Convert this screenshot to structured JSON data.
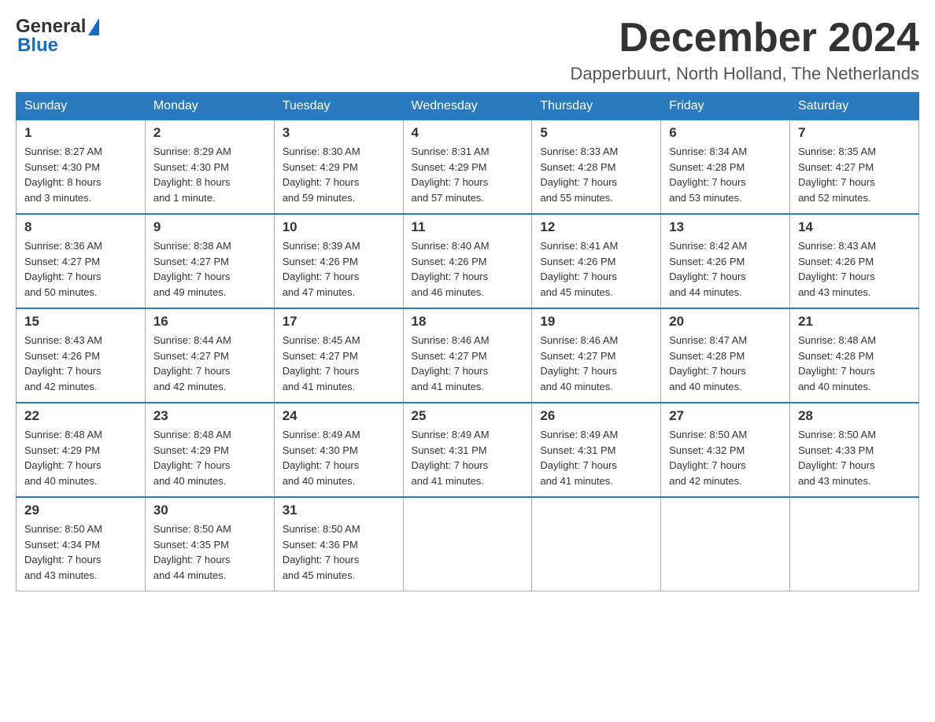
{
  "header": {
    "logo_general": "General",
    "logo_blue": "Blue",
    "month_title": "December 2024",
    "location": "Dapperbuurt, North Holland, The Netherlands"
  },
  "weekdays": [
    "Sunday",
    "Monday",
    "Tuesday",
    "Wednesday",
    "Thursday",
    "Friday",
    "Saturday"
  ],
  "weeks": [
    [
      {
        "day": "1",
        "sunrise": "Sunrise: 8:27 AM",
        "sunset": "Sunset: 4:30 PM",
        "daylight": "Daylight: 8 hours",
        "extra": "and 3 minutes."
      },
      {
        "day": "2",
        "sunrise": "Sunrise: 8:29 AM",
        "sunset": "Sunset: 4:30 PM",
        "daylight": "Daylight: 8 hours",
        "extra": "and 1 minute."
      },
      {
        "day": "3",
        "sunrise": "Sunrise: 8:30 AM",
        "sunset": "Sunset: 4:29 PM",
        "daylight": "Daylight: 7 hours",
        "extra": "and 59 minutes."
      },
      {
        "day": "4",
        "sunrise": "Sunrise: 8:31 AM",
        "sunset": "Sunset: 4:29 PM",
        "daylight": "Daylight: 7 hours",
        "extra": "and 57 minutes."
      },
      {
        "day": "5",
        "sunrise": "Sunrise: 8:33 AM",
        "sunset": "Sunset: 4:28 PM",
        "daylight": "Daylight: 7 hours",
        "extra": "and 55 minutes."
      },
      {
        "day": "6",
        "sunrise": "Sunrise: 8:34 AM",
        "sunset": "Sunset: 4:28 PM",
        "daylight": "Daylight: 7 hours",
        "extra": "and 53 minutes."
      },
      {
        "day": "7",
        "sunrise": "Sunrise: 8:35 AM",
        "sunset": "Sunset: 4:27 PM",
        "daylight": "Daylight: 7 hours",
        "extra": "and 52 minutes."
      }
    ],
    [
      {
        "day": "8",
        "sunrise": "Sunrise: 8:36 AM",
        "sunset": "Sunset: 4:27 PM",
        "daylight": "Daylight: 7 hours",
        "extra": "and 50 minutes."
      },
      {
        "day": "9",
        "sunrise": "Sunrise: 8:38 AM",
        "sunset": "Sunset: 4:27 PM",
        "daylight": "Daylight: 7 hours",
        "extra": "and 49 minutes."
      },
      {
        "day": "10",
        "sunrise": "Sunrise: 8:39 AM",
        "sunset": "Sunset: 4:26 PM",
        "daylight": "Daylight: 7 hours",
        "extra": "and 47 minutes."
      },
      {
        "day": "11",
        "sunrise": "Sunrise: 8:40 AM",
        "sunset": "Sunset: 4:26 PM",
        "daylight": "Daylight: 7 hours",
        "extra": "and 46 minutes."
      },
      {
        "day": "12",
        "sunrise": "Sunrise: 8:41 AM",
        "sunset": "Sunset: 4:26 PM",
        "daylight": "Daylight: 7 hours",
        "extra": "and 45 minutes."
      },
      {
        "day": "13",
        "sunrise": "Sunrise: 8:42 AM",
        "sunset": "Sunset: 4:26 PM",
        "daylight": "Daylight: 7 hours",
        "extra": "and 44 minutes."
      },
      {
        "day": "14",
        "sunrise": "Sunrise: 8:43 AM",
        "sunset": "Sunset: 4:26 PM",
        "daylight": "Daylight: 7 hours",
        "extra": "and 43 minutes."
      }
    ],
    [
      {
        "day": "15",
        "sunrise": "Sunrise: 8:43 AM",
        "sunset": "Sunset: 4:26 PM",
        "daylight": "Daylight: 7 hours",
        "extra": "and 42 minutes."
      },
      {
        "day": "16",
        "sunrise": "Sunrise: 8:44 AM",
        "sunset": "Sunset: 4:27 PM",
        "daylight": "Daylight: 7 hours",
        "extra": "and 42 minutes."
      },
      {
        "day": "17",
        "sunrise": "Sunrise: 8:45 AM",
        "sunset": "Sunset: 4:27 PM",
        "daylight": "Daylight: 7 hours",
        "extra": "and 41 minutes."
      },
      {
        "day": "18",
        "sunrise": "Sunrise: 8:46 AM",
        "sunset": "Sunset: 4:27 PM",
        "daylight": "Daylight: 7 hours",
        "extra": "and 41 minutes."
      },
      {
        "day": "19",
        "sunrise": "Sunrise: 8:46 AM",
        "sunset": "Sunset: 4:27 PM",
        "daylight": "Daylight: 7 hours",
        "extra": "and 40 minutes."
      },
      {
        "day": "20",
        "sunrise": "Sunrise: 8:47 AM",
        "sunset": "Sunset: 4:28 PM",
        "daylight": "Daylight: 7 hours",
        "extra": "and 40 minutes."
      },
      {
        "day": "21",
        "sunrise": "Sunrise: 8:48 AM",
        "sunset": "Sunset: 4:28 PM",
        "daylight": "Daylight: 7 hours",
        "extra": "and 40 minutes."
      }
    ],
    [
      {
        "day": "22",
        "sunrise": "Sunrise: 8:48 AM",
        "sunset": "Sunset: 4:29 PM",
        "daylight": "Daylight: 7 hours",
        "extra": "and 40 minutes."
      },
      {
        "day": "23",
        "sunrise": "Sunrise: 8:48 AM",
        "sunset": "Sunset: 4:29 PM",
        "daylight": "Daylight: 7 hours",
        "extra": "and 40 minutes."
      },
      {
        "day": "24",
        "sunrise": "Sunrise: 8:49 AM",
        "sunset": "Sunset: 4:30 PM",
        "daylight": "Daylight: 7 hours",
        "extra": "and 40 minutes."
      },
      {
        "day": "25",
        "sunrise": "Sunrise: 8:49 AM",
        "sunset": "Sunset: 4:31 PM",
        "daylight": "Daylight: 7 hours",
        "extra": "and 41 minutes."
      },
      {
        "day": "26",
        "sunrise": "Sunrise: 8:49 AM",
        "sunset": "Sunset: 4:31 PM",
        "daylight": "Daylight: 7 hours",
        "extra": "and 41 minutes."
      },
      {
        "day": "27",
        "sunrise": "Sunrise: 8:50 AM",
        "sunset": "Sunset: 4:32 PM",
        "daylight": "Daylight: 7 hours",
        "extra": "and 42 minutes."
      },
      {
        "day": "28",
        "sunrise": "Sunrise: 8:50 AM",
        "sunset": "Sunset: 4:33 PM",
        "daylight": "Daylight: 7 hours",
        "extra": "and 43 minutes."
      }
    ],
    [
      {
        "day": "29",
        "sunrise": "Sunrise: 8:50 AM",
        "sunset": "Sunset: 4:34 PM",
        "daylight": "Daylight: 7 hours",
        "extra": "and 43 minutes."
      },
      {
        "day": "30",
        "sunrise": "Sunrise: 8:50 AM",
        "sunset": "Sunset: 4:35 PM",
        "daylight": "Daylight: 7 hours",
        "extra": "and 44 minutes."
      },
      {
        "day": "31",
        "sunrise": "Sunrise: 8:50 AM",
        "sunset": "Sunset: 4:36 PM",
        "daylight": "Daylight: 7 hours",
        "extra": "and 45 minutes."
      },
      null,
      null,
      null,
      null
    ]
  ]
}
